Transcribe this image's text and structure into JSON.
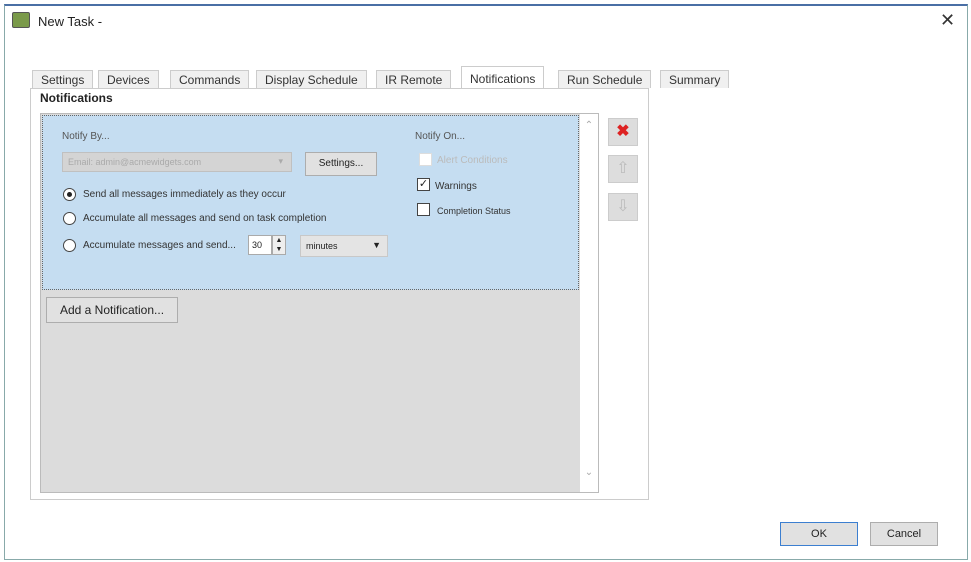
{
  "window": {
    "title": "New Task -",
    "close": "✕"
  },
  "tabs": [
    "Settings",
    "Devices",
    "Commands",
    "Display Schedule",
    "IR Remote",
    "Notifications",
    "Run Schedule",
    "Summary"
  ],
  "panel_title": "Notifications",
  "notification": {
    "notify_by_label": "Notify By...",
    "email_value": "Email: admin@acmewidgets.com",
    "settings_button": "Settings...",
    "radios": [
      "Send all messages immediately as they occur",
      "Accumulate all messages and send on task completion",
      "Accumulate messages and send..."
    ],
    "selected_radio": 0,
    "interval_value": "30",
    "interval_unit": "minutes",
    "notify_on_label": "Notify On...",
    "checkboxes": [
      {
        "label": "Alert Conditions",
        "checked": false,
        "disabled": true
      },
      {
        "label": "Warnings",
        "checked": true
      },
      {
        "label": "Completion Status",
        "checked": false
      }
    ]
  },
  "add_button": "Add a Notification...",
  "buttons": {
    "ok": "OK",
    "cancel": "Cancel"
  }
}
